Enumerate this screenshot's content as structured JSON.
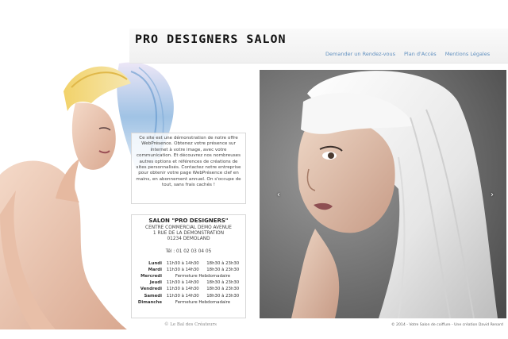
{
  "header": {
    "logo_text": "PRO DESIGNERS SALON"
  },
  "nav": {
    "items": [
      {
        "label": "Demander un Rendez-vous"
      },
      {
        "label": "Plan d'Accès"
      },
      {
        "label": "Mentions Légales"
      }
    ]
  },
  "info": {
    "text": "Ce site est une démonstration de notre offre WebPrésence. Obtenez votre présence sur internet à votre image, avec votre communication. Et découvrez nos nombreuses autres options et références de créations de sites personnalisés. Contactez notre entreprise pour obtenir votre page WebPrésence clef en mains, en abonnement annuel. On s'occupe de tout, sans frais cachés !"
  },
  "contact": {
    "name": "SALON \"PRO DESIGNERS\"",
    "address_line1": "CENTRE COMMERCIAL DEMO AVENUE",
    "address_line2": "1 RUE DE LA DEMONSTRATION",
    "address_line3": "01234 DEMOLAND",
    "tel": "Tél : 01 02 03 04 05",
    "hours": [
      {
        "day": "Lundi",
        "am": "11h30 à 14h30",
        "pm": "18h30 à 23h30",
        "closed": ""
      },
      {
        "day": "Mardi",
        "am": "11h30 à 14h30",
        "pm": "18h30 à 23h30",
        "closed": ""
      },
      {
        "day": "Mercredi",
        "am": "",
        "pm": "",
        "closed": "Fermeture Hebdomadaire"
      },
      {
        "day": "Jeudi",
        "am": "11h30 à 14h30",
        "pm": "18h30 à 23h30",
        "closed": ""
      },
      {
        "day": "Vendredi",
        "am": "11h30 à 14h30",
        "pm": "18h30 à 23h30",
        "closed": ""
      },
      {
        "day": "Samedi",
        "am": "11h30 à 14h30",
        "pm": "18h30 à 23h30",
        "closed": ""
      },
      {
        "day": "Dimanche",
        "am": "",
        "pm": "",
        "closed": "Fermeture Hebdomadaire"
      }
    ]
  },
  "credits": {
    "left": "© Le Bal des Créateurs",
    "footer": "© 2014 - Votre Salon de coiffure - Une création David Renard"
  },
  "slider": {
    "prev_icon": "chevron-left-icon",
    "next_icon": "chevron-right-icon",
    "prev_glyph": "‹",
    "next_glyph": "›"
  },
  "colors": {
    "nav_link": "#5f8fbf",
    "slider_bg": "#7a7a7a"
  }
}
